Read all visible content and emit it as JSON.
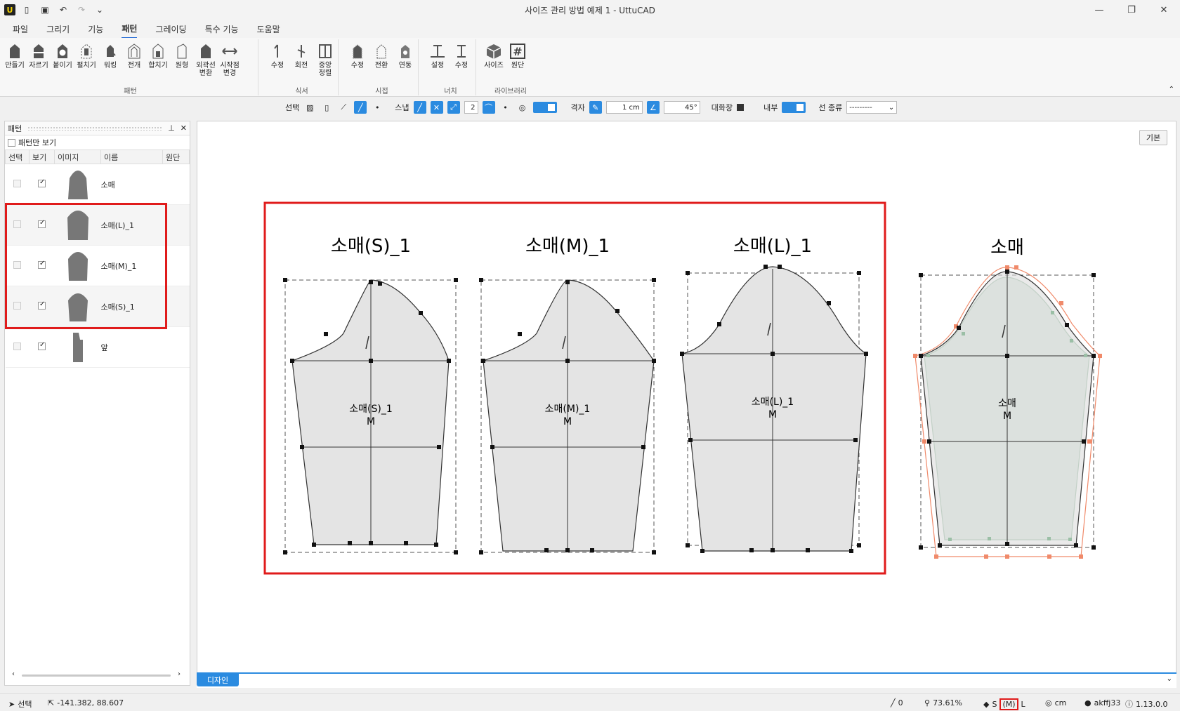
{
  "window": {
    "title": "사이즈 관리 방법 예제 1 - UttuCAD",
    "app_logo": "U"
  },
  "menu": {
    "tabs": [
      "파일",
      "그리기",
      "기능",
      "패턴",
      "그레이딩",
      "특수 기능",
      "도움말"
    ],
    "active": "패턴"
  },
  "ribbon": {
    "groups": [
      {
        "label": "패턴",
        "buttons": [
          "만들기",
          "자르기",
          "붙이기",
          "펼치기",
          "워킹",
          "전개",
          "합치기",
          "원형",
          "외곽선\n변환",
          "시작점\n변경"
        ]
      },
      {
        "label": "식서",
        "buttons": [
          "수정",
          "회전",
          "중앙\n정렬"
        ]
      },
      {
        "label": "시접",
        "buttons": [
          "수정",
          "전환",
          "연동"
        ]
      },
      {
        "label": "너치",
        "buttons": [
          "설정",
          "수정"
        ]
      },
      {
        "label": "라이브러리",
        "buttons": [
          "사이즈",
          "원단"
        ]
      }
    ]
  },
  "toolbar2": {
    "select_label": "선택",
    "snap_label": "스냅",
    "snap_value": "2",
    "grid_label": "격자",
    "grid_value": "1 cm",
    "angle_value": "45°",
    "dialog_label": "대화창",
    "inner_label": "내부",
    "line_type_label": "선 종류",
    "line_type_value": "---------"
  },
  "pattern_panel": {
    "title": "패턴",
    "show_only_label": "패턴만 보기",
    "columns": [
      "선택",
      "보기",
      "이미지",
      "이름",
      "원단"
    ],
    "rows": [
      {
        "name": "소매",
        "visible": true
      },
      {
        "name": "소매(L)_1",
        "visible": true
      },
      {
        "name": "소매(M)_1",
        "visible": true
      },
      {
        "name": "소매(S)_1",
        "visible": true
      },
      {
        "name": "앞",
        "visible": true
      }
    ]
  },
  "canvas": {
    "basic_button": "기본",
    "pieces": [
      {
        "title": "소매(S)_1",
        "label": "소매(S)_1",
        "size": "M"
      },
      {
        "title": "소매(M)_1",
        "label": "소매(M)_1",
        "size": "M"
      },
      {
        "title": "소매(L)_1",
        "label": "소매(L)_1",
        "size": "M"
      },
      {
        "title": "소매",
        "label": "소매",
        "size": "M"
      }
    ],
    "design_tab": "디자인"
  },
  "status": {
    "mode": "선택",
    "coords": "-141.382, 88.607",
    "line_count": "0",
    "zoom": "73.61%",
    "size_prefix": "S",
    "size": "(M)",
    "size_suffix": "L",
    "unit": "cm",
    "user": "akffj33",
    "version": "1.13.0.0"
  },
  "colors": {
    "accent": "#2b8be0",
    "highlight_red": "#e01b1b",
    "piece_fill": "#e4e4e4",
    "graded_orange": "#f08a6a"
  }
}
